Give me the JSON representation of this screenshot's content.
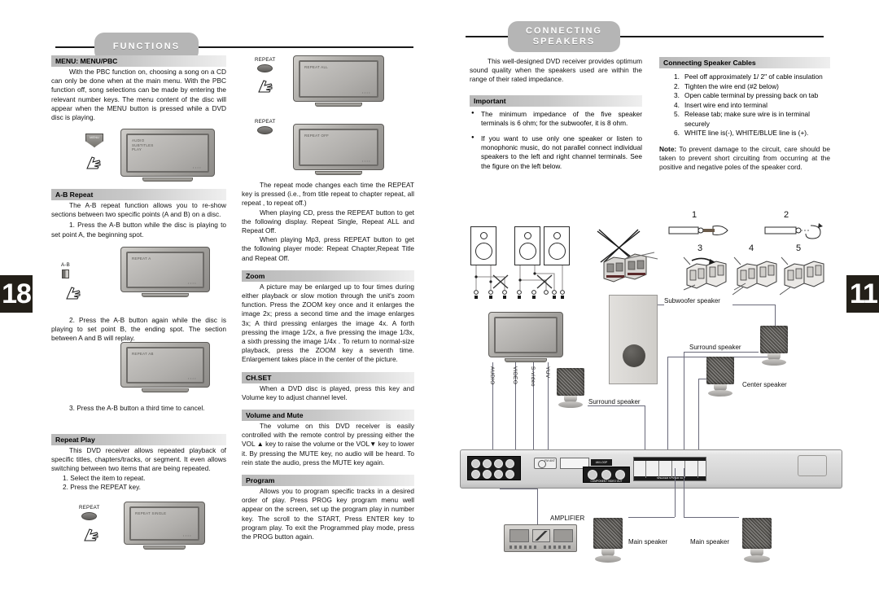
{
  "left_page": {
    "page_number": "18",
    "banner": "FUNCTIONS",
    "banner_line1": "FUNCTIONS",
    "sections": {
      "menu": {
        "heading": "MENU: MENU/PBC",
        "body": "With the PBC function on, choosing a song on a CD can only be done when at the main menu. With the PBC function off, song selections can be made by entering the relevant number keys. The menu content of the disc will appear when the MENU button is pressed while a DVD disc is playing.",
        "key_label": "MENU",
        "tv_osd": [
          "AUDIO",
          "SUBTITLES",
          "PLAY"
        ]
      },
      "ab_repeat": {
        "heading": "A-B Repeat",
        "body": "The A-B repeat function allows you to re-show sections between two specific points (A and B) on a disc.",
        "step1": "1. Press the A-B button while the disc is playing to set point A, the beginning spot.",
        "step2": "2. Press the A-B button again while the disc is playing to set point B, the ending spot. The section between A and B will replay.",
        "step3": "3. Press the A-B button a third time to cancel.",
        "key_label": "A-B",
        "tv_osd_1": "REPEAT A",
        "tv_osd_2": "REPEAT AB"
      },
      "repeat_play": {
        "heading": "Repeat Play",
        "body": "This DVD receiver allows repeated playback of specific titles, chapters/tracks, or segment. It even allows switching between two items that are being repeated.",
        "step1": "1. Select the item to repeat.",
        "step2": "2. Press the REPEAT key.",
        "key_label": "REPEAT",
        "tv_osd": "REPEAT SINGLE"
      },
      "repeat_modes": {
        "key_label_1": "REPEAT",
        "key_label_2": "REPEAT",
        "tv_osd_1": "REPEAT ALL",
        "tv_osd_2": "REPEAT OFF",
        "para1": "The repeat mode changes each time the REPEAT key is pressed (i.e., from title repeat to chapter repeat, all repeat , to repeat off.)",
        "para2": "When playing CD, press the REPEAT button to get the following display.  Repeat Single, Repeat ALL and Repeat Off.",
        "para3": "When playing Mp3, press REPEAT button to get the following player mode: Repeat Chapter,Repeat Title and Repeat Off."
      },
      "zoom": {
        "heading": "Zoom",
        "body": "A picture may be enlarged up to four times during either playback or slow motion through the unit's zoom function. Press the ZOOM key once and it enlarges the image 2x; press a second time and the image enlarges 3x; A third pressing enlarges the image 4x. A forth pressing the image 1/2x, a five pressing the image 1/3x, a sixth pressing the image 1/4x . To return to normal-size playback, press the ZOOM key a seventh time. Enlargement takes place in the center of the picture."
      },
      "chset": {
        "heading": "CH.SET",
        "body": "When a DVD disc is played, press this key and Volume key to adjust channel level."
      },
      "volume": {
        "heading": "Volume and Mute",
        "body": "The volume on this DVD receiver is easily controlled with the remote control by pressing either the VOL ▲ key to raise the volume or the VOL▼ key to lower it. By pressing the MUTE key, no audio will be heard. To rein state the audio, press the MUTE key again."
      },
      "program": {
        "heading": "Program",
        "body": "Allows you to program specific tracks in a desired order of play.  Press PROG key program menu well appear on the screen, set up the program play in number key. The scroll to the START, Press ENTER key to program play.  To exit the Programmed play mode, press the PROG button again."
      }
    }
  },
  "right_page": {
    "page_number": "11",
    "banner_line1": "CONNECTING",
    "banner_line2": "SPEAKERS",
    "intro": "This well-designed DVD receiver provides optimum sound quality when the speakers used are within the range of their rated impedance.",
    "important": {
      "heading": "Important",
      "bullets": [
        "The minimum impedance of the five speaker terminals is 6 ohm; for the subwoofer, it is 8 ohm.",
        "If you want to use only one speaker or listen to monophonic music, do not parallel connect individual speakers to the left and right channel terminals. See the figure on the left below."
      ]
    },
    "cables": {
      "heading": "Connecting Speaker Cables",
      "steps": [
        "Peel off approximately 1/ 2\" of cable insulation",
        "Tighten the wire end (#2 below)",
        "Open cable terminal by pressing back on tab",
        "Insert wire end into terminal",
        "Release tab; make sure wire is in terminal securely",
        "WHITE line is(-), WHITE/BLUE line is (+)."
      ],
      "note_label": "Note:",
      "note_body": " To prevent damage to the circuit, care should be taken to prevent short circuiting from occurring at the positive and negative poles of the speaker cord."
    },
    "cable_steps_numbers": [
      "1",
      "2",
      "3",
      "4",
      "5"
    ],
    "diagram_labels": {
      "subwoofer": "Subwoofer speaker",
      "surround_right": "Surround speaker",
      "surround_left": "Surround speaker",
      "center": "Center speaker",
      "main_left": "Main speaker",
      "main_right": "Main speaker",
      "amplifier": "AMPLIFIER",
      "tv_outputs": [
        "AUDIO",
        "VIDEO",
        "S-video",
        "YUV"
      ],
      "component_out": "COMPONENT VIDEO OUT",
      "speaker_terminal": "SPEAKER  SYSTEM 6Ω",
      "fm_ant": "FM ANT",
      "am_loop": "AM LOOP"
    }
  }
}
